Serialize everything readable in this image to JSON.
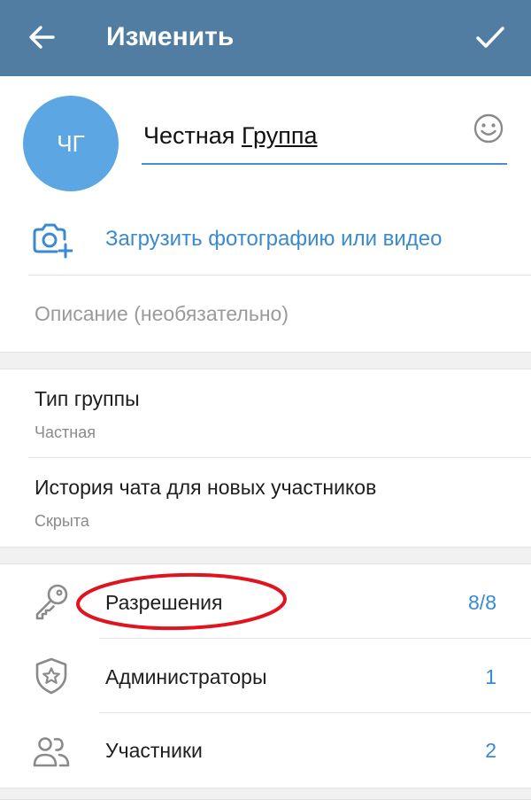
{
  "header": {
    "title": "Изменить",
    "bg_color": "#517da2",
    "back_icon": "arrow-left-icon",
    "confirm_icon": "checkmark-icon"
  },
  "profile": {
    "avatar_initials": "ЧГ",
    "avatar_color": "#5ba6e3",
    "name_part1": "Честная",
    "name_part2": "Группа",
    "emoji_icon": "smiley-icon"
  },
  "upload": {
    "label": "Загрузить фотографию или видео",
    "icon": "camera-add-icon",
    "color": "#3a8ad0"
  },
  "description": {
    "placeholder": "Описание (необязательно)"
  },
  "settings": {
    "group_type": {
      "title": "Тип группы",
      "value": "Частная"
    },
    "chat_history": {
      "title": "История чата для новых участников",
      "value": "Скрыта"
    }
  },
  "management": {
    "items": [
      {
        "label": "Разрешения",
        "value": "8/8",
        "icon": "key-icon"
      },
      {
        "label": "Администраторы",
        "value": "1",
        "icon": "shield-star-icon"
      },
      {
        "label": "Участники",
        "value": "2",
        "icon": "people-icon"
      }
    ],
    "highlight_color": "#e0141e"
  }
}
